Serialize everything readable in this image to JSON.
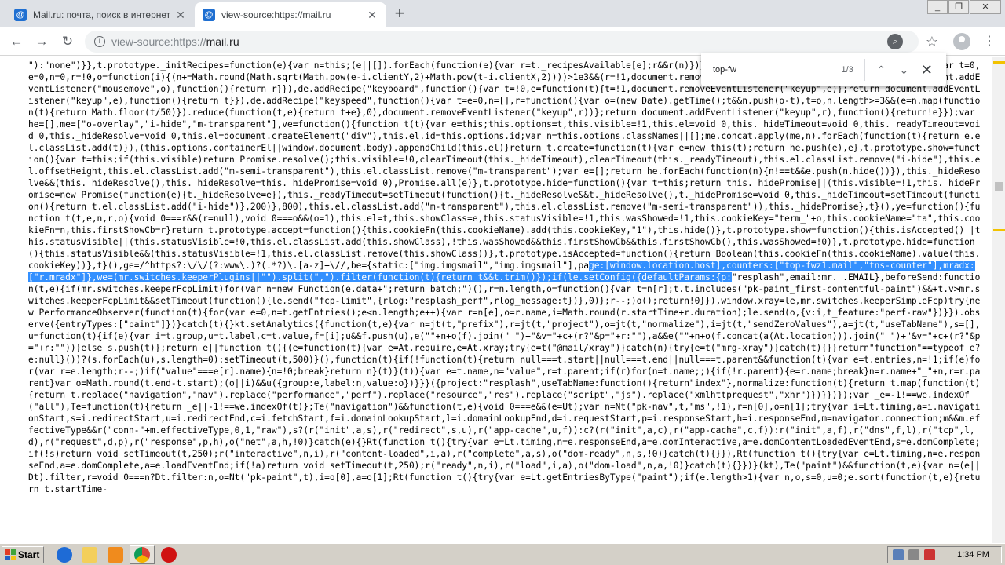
{
  "tabs": [
    {
      "title": "Mail.ru: почта, поиск в интернете, новости, игры",
      "favicon": "@",
      "active": false
    },
    {
      "title": "view-source:https://mail.ru",
      "favicon": "@",
      "active": true
    }
  ],
  "toolbar": {
    "url_scheme": "view-source:https://",
    "url_host": "mail.ru"
  },
  "find": {
    "query": "top-fw",
    "count": "1/3"
  },
  "source": {
    "before_selection": "\"):\"none\")}},t.prototype._initRecipes=function(e){var n=this;(e||[]).forEach(function(e){var r=t._recipesAvailable[e];r&&r(n)})},t}(),pe=de;de.addRecipe(\"mouse\",function(){var t=0,e=0,n=0,r=!0,o=function(i){(n+=Math.round(Math.sqrt(Math.pow(e-i.clientY,2)+Math.pow(t-i.clientX,2))))>1e3&&(r=!1,document.removeEventListener(\"mousemove\",o))};return document.addEventListener(\"mousemove\",o),function(){return r}}),de.addRecipe(\"keyboard\",function(){var t=!0,e=function(t){t=!1,document.removeEventListener(\"keyup\",e)};return document.addEventListener(\"keyup\",e),function(){return t}}),de.addRecipe(\"keyspeed\",function(){var t=e=0,n=[],r=function(){var o=(new Date).getTime();t&&n.push(o-t),t=o,n.length>=3&&(e=n.map(function(t){return Math.floor(t/50)}).reduce(function(t,e){return t+e},0),document.removeEventListener(\"keyup\",r))};return document.addEventListener(\"keyup\",r),function(){return!e}});var he=[],me=[\"o-overlay\",\"i-hide\",\"m-transparent\"],ve=function(){function t(t){var e=this;this.options=t,this.visible=!1,this.el=void 0,this._hideTimeout=void 0,this._readyTimeout=void 0,this._hideResolve=void 0,this.el=document.createElement(\"div\"),this.el.id=this.options.id;var n=this.options.classNames||[];me.concat.apply(me,n).forEach(function(t){return e.el.classList.add(t)}),(this.options.containerEl||window.document.body).appendChild(this.el)}return t.create=function(t){var e=new this(t);return he.push(e),e},t.prototype.show=function(){var t=this;if(this.visible)return Promise.resolve();this.visible=!0,clearTimeout(this._hideTimeout),clearTimeout(this._readyTimeout),this.el.classList.remove(\"i-hide\"),this.el.offsetHeight,this.el.classList.add(\"m-semi-transparent\"),this.el.classList.remove(\"m-transparent\");var e=[];return he.forEach(function(n){n!==t&&e.push(n.hide())}),this._hideResolve&&(this._hideResolve(),this._hideResolve=this._hidePromise=void 0),Promise.all(e)},t.prototype.hide=function(){var t=this;return this._hidePromise||(this.visible=!1,this._hidePromise=new Promise(function(e){t._hideResolve=e}),this._readyTimeout=setTimeout(function(){t._hideResolve&&t._hideResolve(),t._hidePromise=void 0,this._hideTimeout=setTimeout(function(){return t.el.classList.add(\"i-hide\")},200)},800),this.el.classList.add(\"m-transparent\"),this.el.classList.remove(\"m-semi-transparent\")),this._hidePromise},t}(),ye=function(){function t(t,e,n,r,o){void 0===r&&(r=null),void 0===o&&(o=1),this.el=t,this.showClass=e,this.statusVisible=!1,this.wasShowed=!1,this.cookieKey=\"term_\"+o,this.cookieName=\"ta\",this.cookieFn=n,this.firstShowCb=r}return t.prototype.accept=function(){this.cookieFn(this.cookieName).add(this.cookieKey,\"1\"),this.hide()},t.prototype.show=function(){this.isAccepted()||this.statusVisible||(this.statusVisible=!0,this.el.classList.add(this.showClass),!this.wasShowed&&this.firstShowCb&&this.firstShowCb(),this.wasShowed=!0)},t.prototype.hide=function(){this.statusVisible&&(this.statusVisible=!1,this.el.classList.remove(this.showClass))},t.prototype.isAccepted=function(){return Boolean(this.cookieFn(this.cookieName).value(this.cookieKey))},t}(),ge=/^https?:\\/\\/(?:www\\.)?(.*?)\\.[a-z]+\\//,be={static:[\"img.imgsmail\",\"img.imgsmail\"],pa",
    "selection": "ge:[window.location.host],counters:[\"top-fwz1.mail\",\"tns-counter\"],mradx:[\"r.mradx\"]},we=(mr.switches.keeperPlugins||\"\").split(\",\").filter(function(t){return t&&t.trim()});if(le.setConfig({defaultParams:{p:",
    "after_selection": "\"resplash\",email:mr._.EMAIL},beforeSend:function(t,e){if(mr.switches.keeperFcpLimit)for(var n=new Function(e.data+\";return batch;\")(),r=n.length,o=function(){var t=n[r];t.t.includes(\"pk-paint_first-contentful-paint\")&&+t.v>mr.switches.keeperFcpLimit&&setTimeout(function(){le.send(\"fcp-limit\",{rlog:\"resplash_perf\",rlog_message:t})},0)};r--;)o();return!0}}),window.xray=le,mr.switches.keeperSimpleFcp)try{new PerformanceObserver(function(t){for(var e=0,n=t.getEntries();e<n.length;e++){var r=n[e],o=r.name,i=Math.round(r.startTime+r.duration);le.send(o,{v:i,t_feature:\"perf-raw\"})}}).observe({entryTypes:[\"paint\"]})}catch(t){}kt.setAnalytics({function(t,e){var n=jt(t,\"prefix\"),r=jt(t,\"project\"),o=jt(t,\"normalize\"),i=jt(t,\"sendZeroValues\"),a=jt(t,\"useTabName\"),s=[],u=function(t){if(e){var i=t.group,u=t.label,c=t.value,f=[i];u&&f.push(u),e(\"\"+n+o(f).join(\"_\")+\"&v=\"+c+(r?\"&p=\"+r:\"\"),a&&e(\"\"+n+o(f.concat(a(At.location))).join(\"_\")+\"&v=\"+c+(r?\"&p=\"+r:\"\"))}else s.push(t)};return e||function t(){(e=function(t){var e=At.require,e=At.xray;try{e=t(\"@mail/xray\")}catch(n){try{e=t(\"mrg-xray\")}catch(t){}}return\"function\"==typeof e?e:null}())?(s.forEach(u),s.length=0):setTimeout(t,500)}(),function(t){if(!function(t){return null===t.start||null===t.end||null===t.parent&&function(t){var e=t.entries,n=!1;if(e)for(var r=e.length;r--;)if(\"value\"===e[r].name){n=!0;break}return n}(t)}(t)){var e=t.name,n=\"value\",r=t.parent;if(r)for(n=t.name;;){if(!r.parent){e=r.name;break}n=r.name+\"_\"+n,r=r.parent}var o=Math.round(t.end-t.start);(o||i)&&u({group:e,label:n,value:o})}}}({project:\"resplash\",useTabName:function(){return\"index\"},normalize:function(t){return t.map(function(t){return t.replace(\"navigation\",\"nav\").replace(\"performance\",\"perf\").replace(\"resource\",\"res\").replace(\"script\",\"js\").replace(\"xmlhttprequest\",\"xhr\")})}})});var _e=-1!==we.indexOf(\"all\"),Te=function(t){return _e||-1!==we.indexOf(t)};Te(\"navigation\")&&function(t,e){void 0===e&&(e=Ut);var n=Nt(\"pk-nav\",t,\"ms\",!1),r=n[0],o=n[1];try{var i=Lt.timing,a=i.navigationStart,s=i.redirectStart,u=i.redirectEnd,c=i.fetchStart,f=i.domainLookupStart,l=i.domainLookupEnd,d=i.requestStart,p=i.responseStart,h=i.responseEnd,m=navigator.connection;m&&m.effectiveType&&r(\"conn-\"+m.effectiveType,0,1,\"raw\"),s?(r(\"init\",a,s),r(\"redirect\",s,u),r(\"app-cache\",u,f)):c?(r(\"init\",a,c),r(\"app-cache\",c,f)):r(\"init\",a,f),r(\"dns\",f,l),r(\"tcp\",l,d),r(\"request\",d,p),r(\"response\",p,h),o(\"net\",a,h,!0)}catch(e){}Rt(function t(){try{var e=Lt.timing,n=e.responseEnd,a=e.domInteractive,a=e.domContentLoadedEventEnd,s=e.domComplete;if(!s)return void setTimeout(t,250);r(\"interactive\",n,i),r(\"content-loaded\",i,a),r(\"complete\",a,s),o(\"dom-ready\",n,s,!0)}catch(t){}}),Rt(function t(){try{var e=Lt.timing,n=e.responseEnd,a=e.domComplete,a=e.loadEventEnd;if(!a)return void setTimeout(t,250);r(\"ready\",n,i),r(\"load\",i,a),o(\"dom-load\",n,a,!0)}catch(t){}})}(kt),Te(\"paint\")&&function(t,e){var n=(e||Dt).filter,r=void 0===n?Dt.filter:n,o=Nt(\"pk-paint\",t),i=o[0],a=o[1];Rt(function t(){try{var e=Lt.getEntriesByType(\"paint\");if(e.length>1){var n,o,s=0,u=0;e.sort(function(t,e){return t.startTime-"
  },
  "taskbar": {
    "start_label": "Start",
    "clock": "1:34 PM"
  },
  "colors": {
    "selection": "#3390ff",
    "find_marker": "#f2c200",
    "tab_strip": "#dee1e6"
  },
  "icons": {
    "back": "back-arrow-icon",
    "forward": "forward-arrow-icon",
    "reload": "reload-icon",
    "info": "info-icon",
    "lens": "lens-icon",
    "bookmark": "star-icon",
    "profile": "avatar",
    "menu": "menu-icon"
  }
}
